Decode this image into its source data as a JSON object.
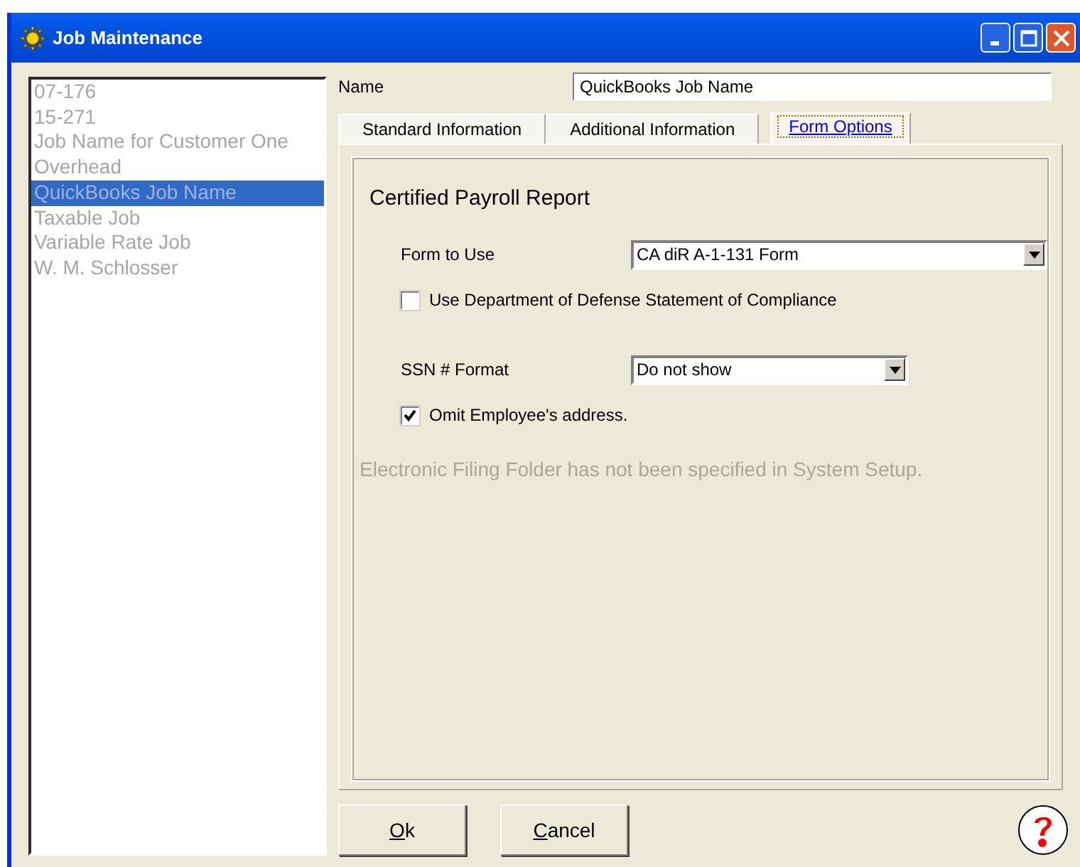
{
  "window": {
    "title": "Job Maintenance"
  },
  "jobs": [
    {
      "label": "07-176",
      "selected": false
    },
    {
      "label": "15-271",
      "selected": false
    },
    {
      "label": "Job Name for Customer One",
      "selected": false
    },
    {
      "label": "Overhead",
      "selected": false
    },
    {
      "label": "QuickBooks Job Name",
      "selected": true
    },
    {
      "label": "Taxable Job",
      "selected": false
    },
    {
      "label": "Variable Rate Job",
      "selected": false
    },
    {
      "label": "W. M. Schlosser",
      "selected": false
    }
  ],
  "name": {
    "label": "Name",
    "value": "QuickBooks Job Name"
  },
  "tabs": [
    {
      "label": "Standard Information",
      "selected": false
    },
    {
      "label": "Additional Information",
      "selected": false
    },
    {
      "label": "Form Options",
      "selected": true
    }
  ],
  "form_options": {
    "heading": "Certified Payroll Report",
    "fields": [
      {
        "kind": "dropdown",
        "label": "Form to Use",
        "value": "CA diR A-1-131 Form"
      },
      {
        "kind": "checkbox",
        "label": "Use Department of Defense Statement of Compliance",
        "checked": false
      },
      {
        "kind": "dropdown",
        "label": "SSN # Format",
        "value": "Do not show"
      },
      {
        "kind": "checkbox",
        "label": "Omit Employee's address.",
        "checked": true
      }
    ],
    "notice": "Electronic Filing Folder has not been specified in System Setup."
  },
  "buttons": [
    {
      "label": "Ok"
    },
    {
      "label": "Cancel"
    }
  ]
}
